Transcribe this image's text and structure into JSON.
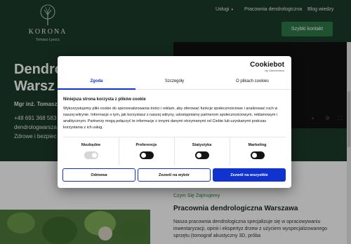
{
  "header": {
    "logo_text": "KORONA",
    "logo_sub": "Tomasz Łyszcz",
    "nav": [
      {
        "label": "Usługi",
        "has_dropdown": true
      },
      {
        "label": "Pracownia dendrologiczna"
      },
      {
        "label": "Blog wiedzy"
      }
    ],
    "cta_label": "Szybki kontakt"
  },
  "hero": {
    "title_line1": "Dendro",
    "title_line2": "Warsz",
    "name": "Mgr inż. Tomasz",
    "phone_line": "+48 691 368 583",
    "line2": "dendrologwarsza",
    "line3": "Zdrowe i bezpiec"
  },
  "services": {
    "tag": "Czym Się Zajmujemy",
    "title": "Pracownia dendrologiczna Warszawa",
    "body": "Nasza pracownia dendrologiczna specjalizuje się w opracowywaniu inwentaryzacji, opinii i ekspertyz drzew z użyciem wyspecjalizowanego sprzętu (tomograf akustyczny 3D, próba"
  },
  "cookie": {
    "brand": "Cookiebot",
    "brand_sub": "by Usercentrics",
    "tabs": [
      "Zgoda",
      "Szczegóły",
      "O plikach cookies"
    ],
    "active_tab": 0,
    "heading": "Niniejsza strona korzysta z plików cookie",
    "body": "Wykorzystujemy pliki cookie do spersonalizowania treści i reklam, aby oferować funkcje społecznościowe i analizować ruch w naszej witrynie. Informacje o tym, jak korzystasz z naszej witryny, udostępniamy partnerom społecznościowym, reklamowym i analitycznym. Partnerzy mogą połączyć te informacje z innymi danymi otrzymanymi od Ciebie lub uzyskanymi podczas korzystania z ich usług.",
    "toggles": [
      {
        "label": "Niezbędne",
        "state": "on",
        "disabled": true
      },
      {
        "label": "Preferencje",
        "state": "off",
        "disabled": false
      },
      {
        "label": "Statystyka",
        "state": "off",
        "disabled": false
      },
      {
        "label": "Marketing",
        "state": "off",
        "disabled": false
      }
    ],
    "buttons": {
      "reject": "Odmowa",
      "allow_selection": "Zezwól na wybór",
      "allow_all": "Zezwól na wszystkie"
    },
    "accent_color": "#1032cf"
  }
}
